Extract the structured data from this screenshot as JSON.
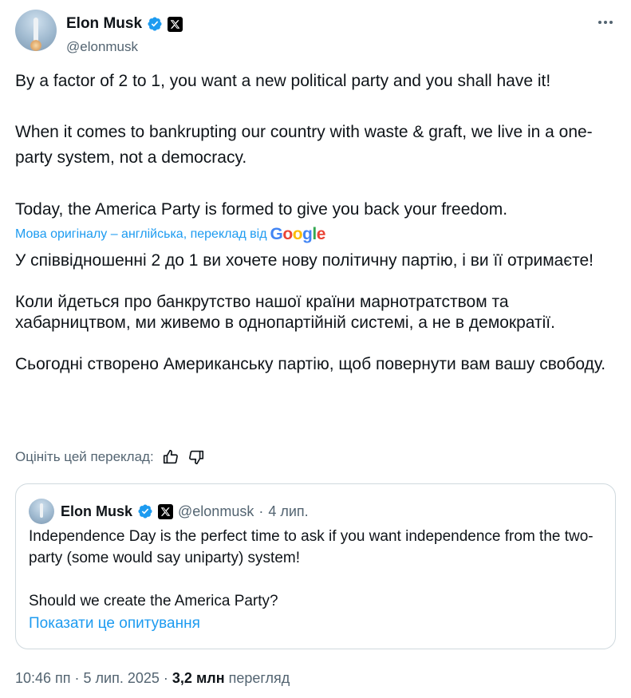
{
  "author": {
    "name": "Elon Musk",
    "handle": "@elonmusk"
  },
  "tweet": {
    "paragraphs": [
      "By a factor of 2 to 1, you want a new political party and you shall have it!",
      "When it comes to bankrupting our country with waste & graft, we live in a one-party system, not a democracy.",
      "Today, the America Party is formed to give you back your freedom."
    ]
  },
  "translation": {
    "note": "Мова оригіналу – англійська, переклад від",
    "provider": "Google",
    "paragraphs": [
      "У співвідношенні 2 до 1 ви хочете нову політичну партію, і ви її отримаєте!",
      "Коли йдеться про банкрутство нашої країни марнотратством та хабарництвом, ми живемо в однопартійній системі, а не в демократії.",
      "Сьогодні створено Американську партію, щоб повернути вам вашу свободу."
    ],
    "rate_label": "Оцініть цей переклад:"
  },
  "quote": {
    "name": "Elon Musk",
    "handle": "@elonmusk",
    "separator": "·",
    "date": "4 лип.",
    "paragraphs": [
      "Independence Day is the perfect time to ask if you want independence from the two-party (some would say uniparty) system!",
      "Should we create the America Party?"
    ],
    "poll_link": "Показати це опитування"
  },
  "meta": {
    "time": "10:46 пп",
    "dot1": "·",
    "date": "5 лип. 2025",
    "dot2": "·",
    "views_count": "3,2 млн",
    "views_label": "перегляд"
  },
  "icons": {
    "verified": "verified-badge-icon",
    "x_logo": "x-logo-icon",
    "more": "more-options-icon",
    "thumbs_up": "thumbs-up-icon",
    "thumbs_down": "thumbs-down-icon"
  },
  "colors": {
    "link": "#1d9bf0",
    "muted": "#536471",
    "text": "#0f1419",
    "border": "#cfd9de"
  }
}
